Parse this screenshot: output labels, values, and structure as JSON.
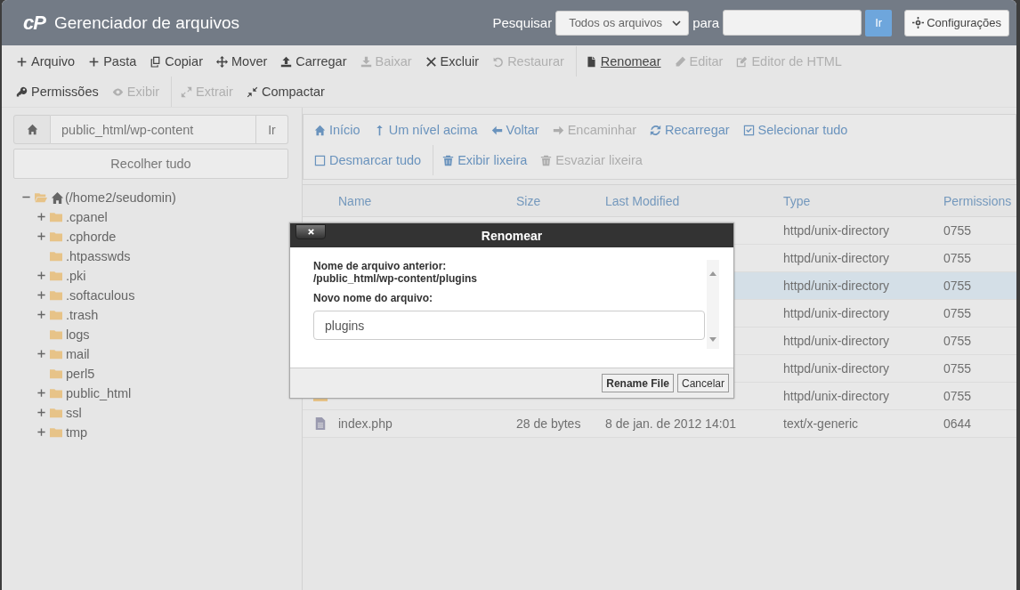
{
  "header": {
    "logo": "cP",
    "title": "Gerenciador de arquivos",
    "search_label": "Pesquisar",
    "search_scope": "Todos os arquivos",
    "for_label": "para",
    "go_button": "Ir",
    "settings_button": "Configurações"
  },
  "toolbar": [
    [
      [
        {
          "label": "Arquivo",
          "disabled": false,
          "hovered": false
        },
        {
          "label": "Pasta",
          "disabled": false,
          "hovered": false
        },
        {
          "label": "Copiar",
          "disabled": false,
          "hovered": false
        },
        {
          "label": "Mover",
          "disabled": false,
          "hovered": false
        },
        {
          "label": "Carregar",
          "disabled": false,
          "hovered": false
        },
        {
          "label": "Baixar",
          "disabled": true,
          "hovered": false
        },
        {
          "label": "Excluir",
          "disabled": false,
          "hovered": false
        },
        {
          "label": "Restaurar",
          "disabled": true,
          "hovered": false
        }
      ],
      [
        {
          "label": "Renomear",
          "disabled": false,
          "hovered": true
        },
        {
          "label": "Editar",
          "disabled": true,
          "hovered": false
        },
        {
          "label": "Editor de HTML",
          "disabled": true,
          "hovered": false
        }
      ]
    ],
    [
      [
        {
          "label": "Permissões",
          "disabled": false,
          "hovered": false
        },
        {
          "label": "Exibir",
          "disabled": true,
          "hovered": false
        }
      ],
      [
        {
          "label": "Extrair",
          "disabled": true,
          "hovered": false
        },
        {
          "label": "Compactar",
          "disabled": false,
          "hovered": false
        }
      ]
    ]
  ],
  "sidebar": {
    "path": "public_html/wp-content",
    "go_button": "Ir",
    "collapse_button": "Recolher tudo",
    "tree": {
      "label": "(/home2/seudomin)",
      "expandable": true,
      "expanded": true,
      "children": [
        {
          "label": ".cpanel",
          "expandable": true,
          "expanded": false
        },
        {
          "label": ".cphorde",
          "expandable": true,
          "expanded": false
        },
        {
          "label": ".htpasswds",
          "expandable": false,
          "expanded": false
        },
        {
          "label": ".pki",
          "expandable": true,
          "expanded": false
        },
        {
          "label": ".softaculous",
          "expandable": true,
          "expanded": false
        },
        {
          "label": ".trash",
          "expandable": true,
          "expanded": false
        },
        {
          "label": "logs",
          "expandable": false,
          "expanded": false
        },
        {
          "label": "mail",
          "expandable": true,
          "expanded": false
        },
        {
          "label": "perl5",
          "expandable": false,
          "expanded": false
        },
        {
          "label": "public_html",
          "expandable": true,
          "expanded": false
        },
        {
          "label": "ssl",
          "expandable": true,
          "expanded": false
        },
        {
          "label": "tmp",
          "expandable": true,
          "expanded": false
        }
      ]
    }
  },
  "navigation": [
    [
      [
        {
          "label": "Início",
          "disabled": false
        },
        {
          "label": "Um nível acima",
          "disabled": false
        },
        {
          "label": "Voltar",
          "disabled": false
        },
        {
          "label": "Encaminhar",
          "disabled": true
        },
        {
          "label": "Recarregar",
          "disabled": false
        },
        {
          "label": "Selecionar tudo",
          "disabled": false
        }
      ]
    ],
    [
      [
        {
          "label": "Desmarcar tudo",
          "disabled": false
        }
      ],
      [
        {
          "label": "Exibir lixeira",
          "disabled": false
        },
        {
          "label": "Esvaziar lixeira",
          "disabled": true
        }
      ]
    ]
  ],
  "table": {
    "columns": [
      "Name",
      "Size",
      "Last Modified",
      "Type",
      "Permissions"
    ],
    "rows": [
      {
        "kind": "folder",
        "type": "httpd/unix-directory",
        "permissions": "0755",
        "selected": false
      },
      {
        "kind": "folder",
        "type": "httpd/unix-directory",
        "permissions": "0755",
        "selected": false
      },
      {
        "kind": "folder",
        "type": "httpd/unix-directory",
        "permissions": "0755",
        "selected": true
      },
      {
        "kind": "folder",
        "type": "httpd/unix-directory",
        "permissions": "0755",
        "selected": false
      },
      {
        "kind": "folder",
        "type": "httpd/unix-directory",
        "permissions": "0755",
        "selected": false
      },
      {
        "kind": "folder",
        "type": "httpd/unix-directory",
        "permissions": "0755",
        "selected": false
      },
      {
        "kind": "folder",
        "type": "httpd/unix-directory",
        "permissions": "0755",
        "selected": false
      },
      {
        "kind": "file",
        "name": "index.php",
        "size": "28 de bytes",
        "modified": "8 de jan. de 2012 14:01",
        "type": "text/x-generic",
        "permissions": "0644",
        "selected": false
      }
    ]
  },
  "dialog": {
    "title": "Renomear",
    "old_label": "Nome de arquivo anterior:",
    "old_path": "/public_html/wp-content/plugins",
    "new_label": "Novo nome do arquivo:",
    "new_value": "plugins",
    "buttons": [
      "Rename File",
      "Cancelar"
    ]
  }
}
